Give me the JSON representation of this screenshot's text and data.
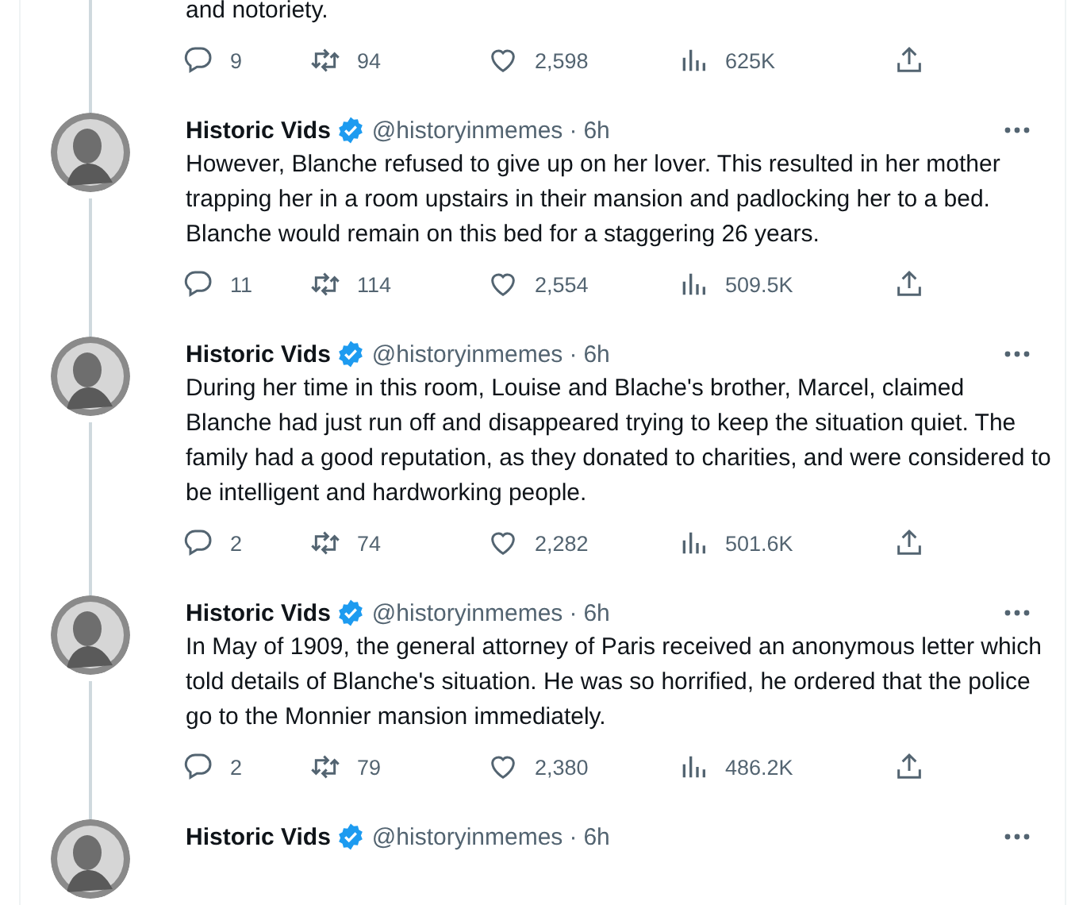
{
  "separator": "·",
  "tweets": [
    {
      "text": "and notoriety.",
      "replies": "9",
      "retweets": "94",
      "likes": "2,598",
      "views": "625K"
    },
    {
      "name": "Historic Vids",
      "verified": true,
      "handle": "@historyinmemes",
      "time": "6h",
      "text": "However, Blanche refused to give up on her lover. This resulted in her mother trapping her in a room upstairs in their mansion and padlocking her to a bed. Blanche would remain on this bed for a staggering 26 years.",
      "replies": "11",
      "retweets": "114",
      "likes": "2,554",
      "views": "509.5K"
    },
    {
      "name": "Historic Vids",
      "verified": true,
      "handle": "@historyinmemes",
      "time": "6h",
      "text": "During her time in this room, Louise and Blache's brother, Marcel, claimed Blanche had just run off and disappeared trying to keep the situation quiet. The family had a good reputation, as they donated to charities, and were considered to be intelligent and hardworking people.",
      "replies": "2",
      "retweets": "74",
      "likes": "2,282",
      "views": "501.6K"
    },
    {
      "name": "Historic Vids",
      "verified": true,
      "handle": "@historyinmemes",
      "time": "6h",
      "text": "In May of 1909, the general attorney of Paris received an anonymous letter which told details of Blanche's situation. He was so horrified, he ordered that the police go to the Monnier mansion immediately.",
      "replies": "2",
      "retweets": "79",
      "likes": "2,380",
      "views": "486.2K"
    },
    {
      "name": "Historic Vids",
      "verified": true,
      "handle": "@historyinmemes",
      "time": "6h"
    }
  ]
}
